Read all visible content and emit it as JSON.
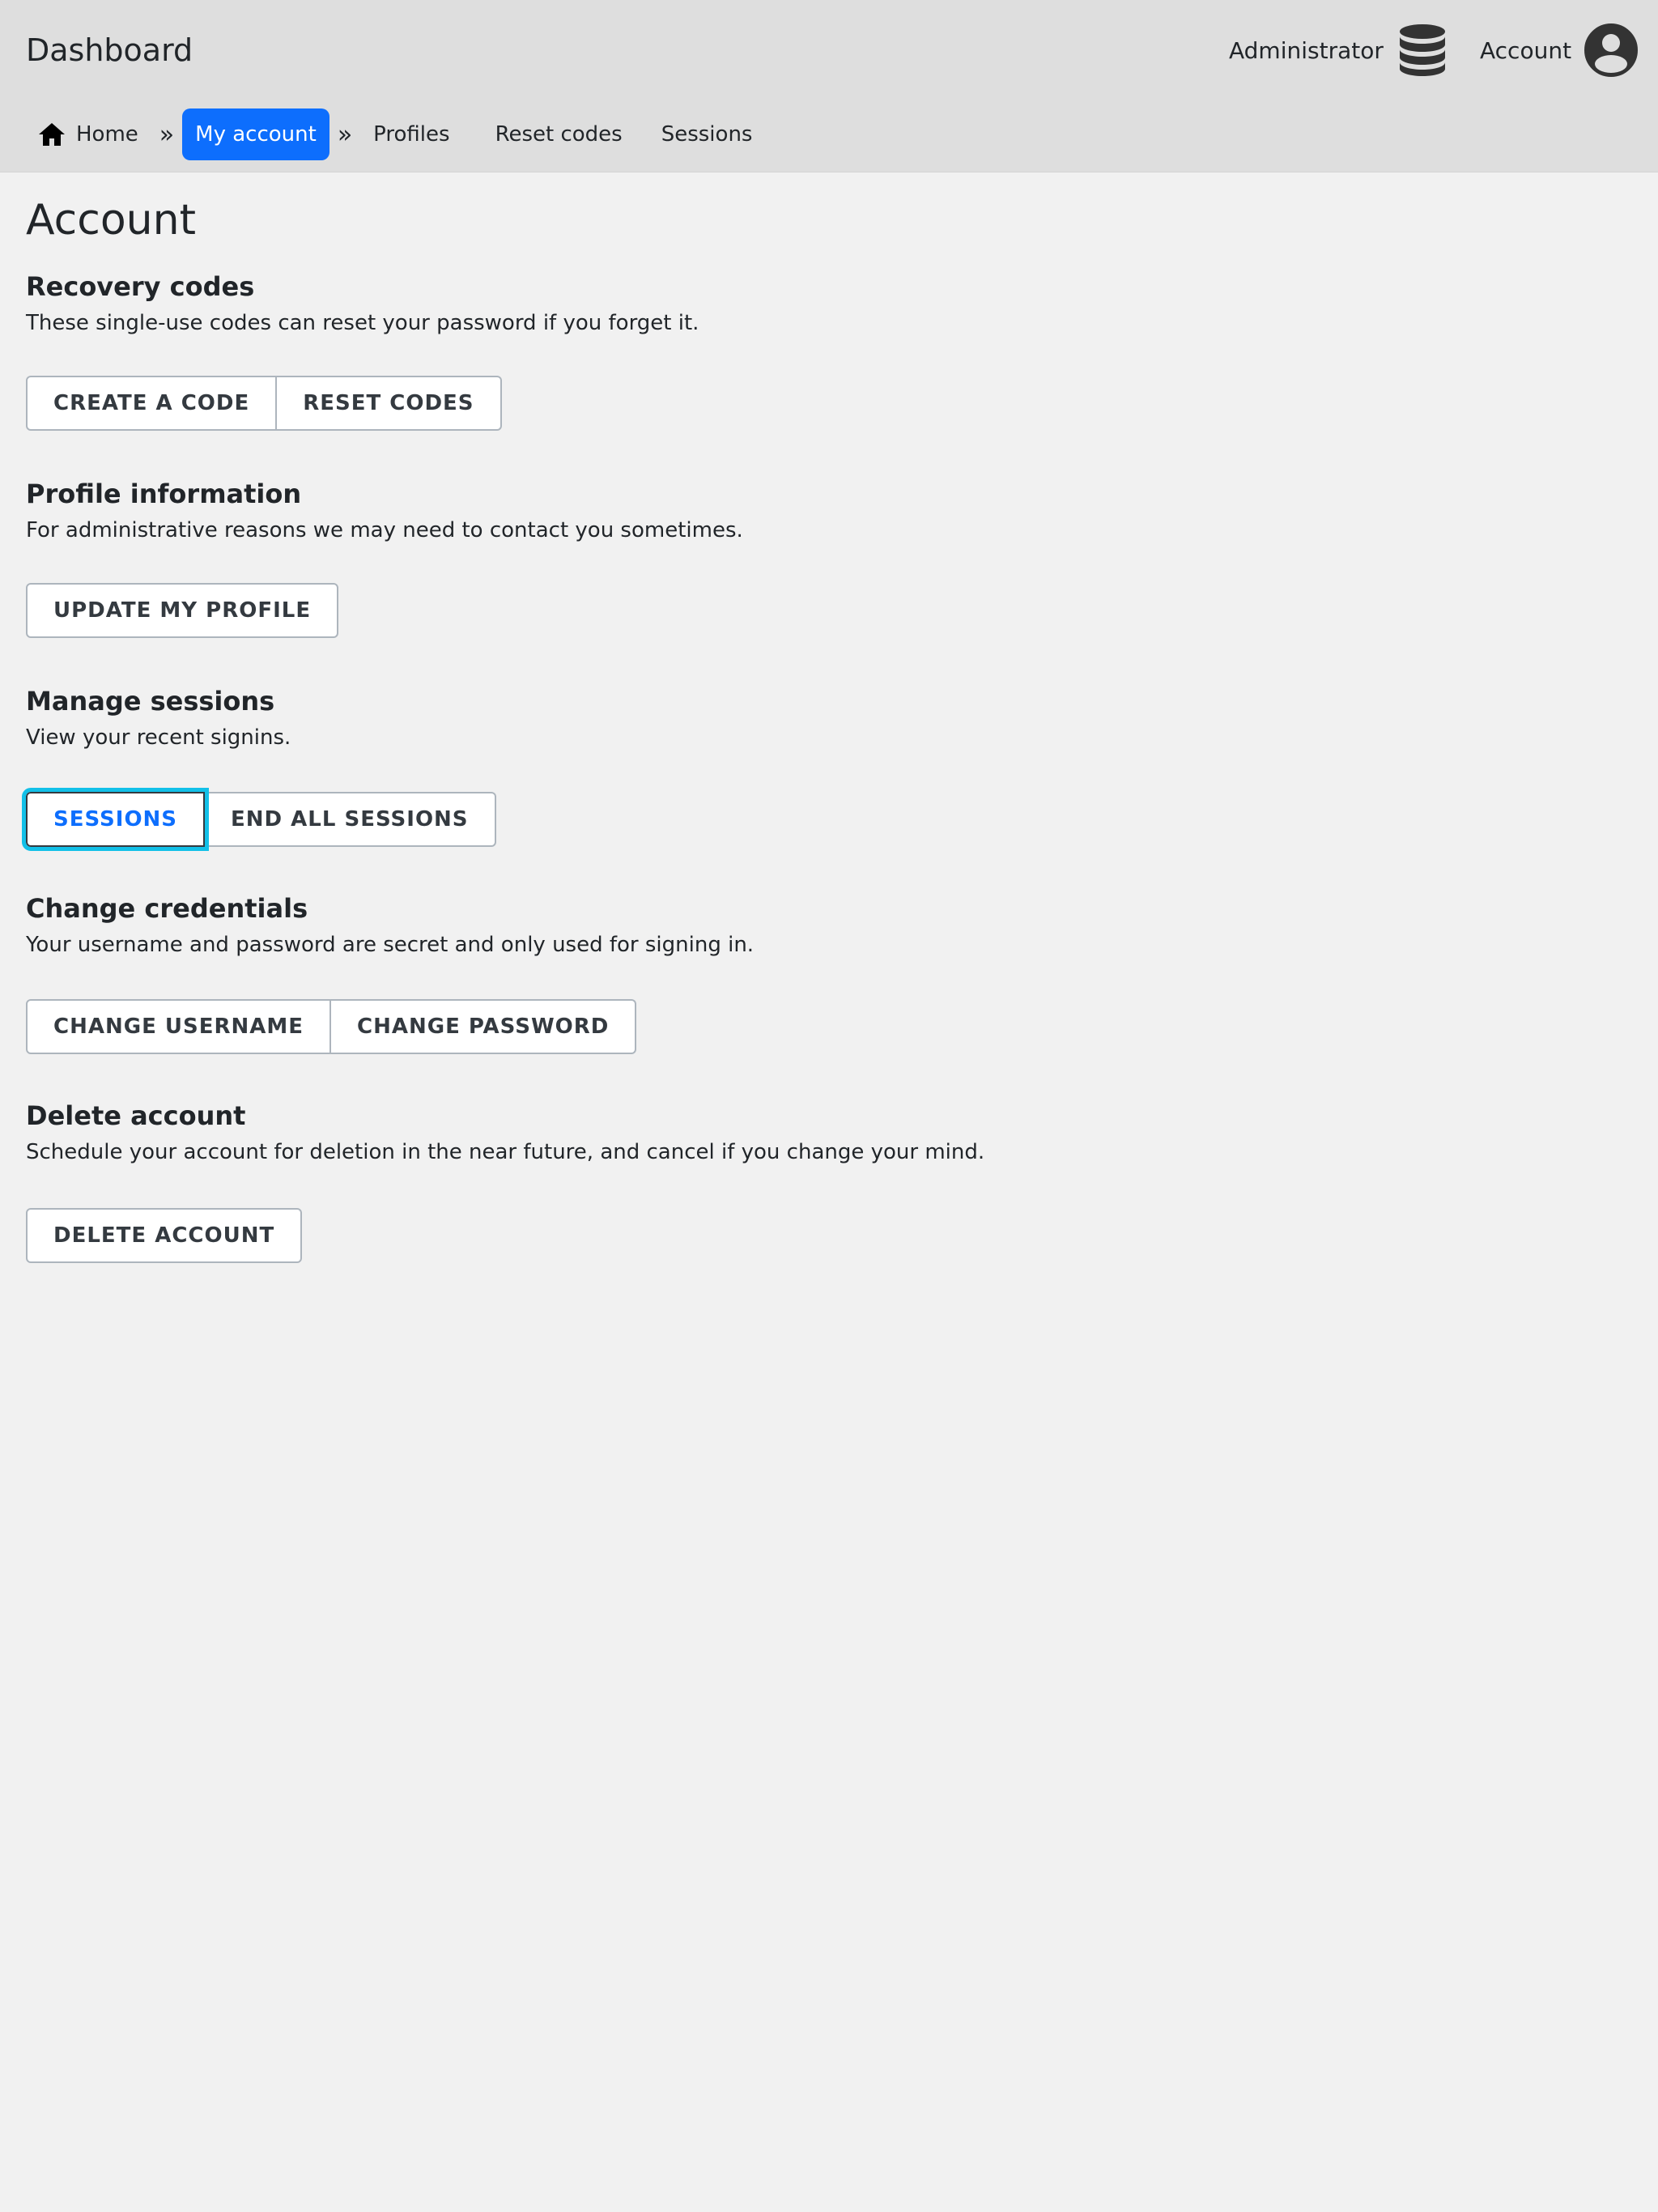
{
  "header": {
    "title": "Dashboard",
    "admin_label": "Administrator",
    "admin_icon": "database-icon",
    "account_label": "Account",
    "account_icon": "user-circle-icon"
  },
  "nav": {
    "home": "Home",
    "separator": "»",
    "my_account": "My account",
    "profiles": "Profiles",
    "reset_codes": "Reset codes",
    "sessions": "Sessions"
  },
  "page": {
    "title": "Account"
  },
  "sections": {
    "recovery": {
      "heading": "Recovery codes",
      "description": "These single-use codes can reset your password if you forget it.",
      "buttons": [
        "CREATE A CODE",
        "RESET CODES"
      ]
    },
    "profile": {
      "heading": "Profile information",
      "description": "For administrative reasons we may need to contact you sometimes.",
      "buttons": [
        "UPDATE MY PROFILE"
      ]
    },
    "sessions": {
      "heading": "Manage sessions",
      "description": "View your recent signins.",
      "buttons": [
        "SESSIONS",
        "END ALL SESSIONS"
      ]
    },
    "credentials": {
      "heading": "Change credentials",
      "description": "Your username and password are secret and only used for signing in.",
      "buttons": [
        "CHANGE USERNAME",
        "CHANGE PASSWORD"
      ]
    },
    "delete": {
      "heading": "Delete account",
      "description": "Schedule your account for deletion in the near future, and cancel if you change your mind.",
      "buttons": [
        "DELETE ACCOUNT"
      ]
    }
  },
  "colors": {
    "accent": "#0d6efd",
    "focus_ring": "#12c0e8",
    "topbar": "#dedede",
    "background": "#f1f1f1"
  }
}
